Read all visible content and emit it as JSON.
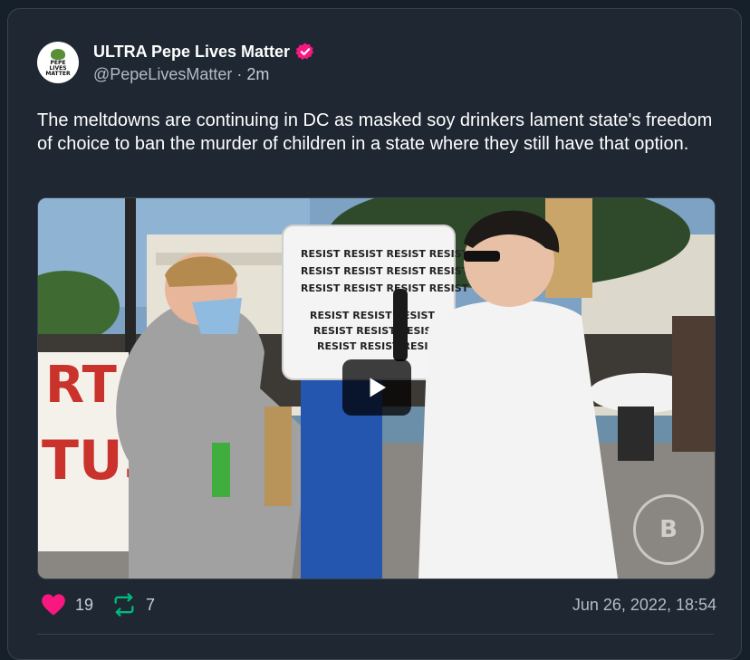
{
  "author": {
    "display_name": "ULTRA Pepe Lives Matter",
    "handle": "@PepeLivesMatter",
    "separator": "·",
    "time_ago": "2m",
    "avatar_text": "PEPE LIVES MATTER"
  },
  "tweet": {
    "text": "The meltdowns are continuing in DC as masked soy drinkers lament state's freedom of choice to ban the murder of children in a state where they still have that option."
  },
  "media": {
    "type": "video",
    "sign_text": [
      "RESIST RESIST RESIST RESIST",
      "RESIST RESIST RESIST RESIST",
      "RESIST RESIST RESIST RESIST",
      "RESIST RESIST RESIST",
      "RESIST RESIST RESIST",
      "RESIST RESIST RESIST"
    ],
    "left_sign_text": [
      "RT",
      "TUS"
    ],
    "watermark": "B"
  },
  "stats": {
    "likes": "19",
    "retweets": "7",
    "date": "Jun 26, 2022, 18:54"
  },
  "colors": {
    "background": "#15202b",
    "card": "#1e2732",
    "like": "#f91880",
    "retweet": "#00ba7c",
    "verified": "#f91880"
  },
  "icons": {
    "verified": "verified-badge-icon",
    "like": "heart-icon",
    "retweet": "retweet-icon",
    "play": "play-icon"
  }
}
